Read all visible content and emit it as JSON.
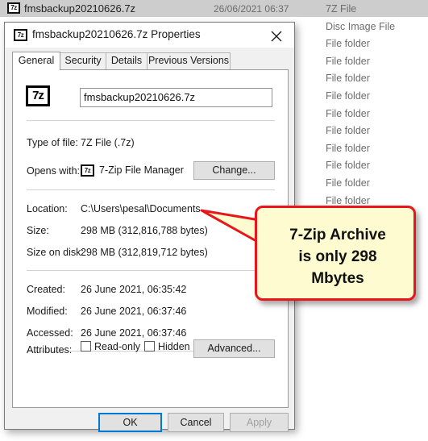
{
  "explorer": {
    "rows": [
      {
        "name": "fmsbackup20210626.7z",
        "date": "26/06/2021 06:37",
        "type": "7Z File",
        "icon": "7z-file-icon",
        "selected": true
      },
      {
        "name": "",
        "date": "",
        "type": "Disc Image File",
        "icon": "",
        "selected": false
      },
      {
        "name": "",
        "date": "",
        "type": "File folder",
        "icon": "",
        "selected": false
      },
      {
        "name": "",
        "date": "",
        "type": "File folder",
        "icon": "",
        "selected": false
      },
      {
        "name": "",
        "date": "",
        "type": "File folder",
        "icon": "",
        "selected": false
      },
      {
        "name": "",
        "date": "",
        "type": "File folder",
        "icon": "",
        "selected": false
      },
      {
        "name": "",
        "date": "",
        "type": "File folder",
        "icon": "",
        "selected": false
      },
      {
        "name": "",
        "date": "",
        "type": "File folder",
        "icon": "",
        "selected": false
      },
      {
        "name": "",
        "date": "",
        "type": "File folder",
        "icon": "",
        "selected": false
      },
      {
        "name": "",
        "date": "",
        "type": "File folder",
        "icon": "",
        "selected": false
      },
      {
        "name": "",
        "date": "",
        "type": "File folder",
        "icon": "",
        "selected": false
      },
      {
        "name": "",
        "date": "",
        "type": "File folder",
        "icon": "",
        "selected": false
      }
    ]
  },
  "dialog": {
    "title": "fmsbackup20210626.7z Properties",
    "title_icon": "7z",
    "close_icon": "close-icon",
    "tabs": [
      {
        "label": "General",
        "active": true
      },
      {
        "label": "Security",
        "active": false
      },
      {
        "label": "Details",
        "active": false
      },
      {
        "label": "Previous Versions",
        "active": false
      }
    ],
    "file_icon_text": "7z",
    "filename": "fmsbackup20210626.7z",
    "fields": [
      {
        "label": "Type of file:",
        "value": "7Z File (.7z)"
      },
      {
        "label": "Opens with:",
        "value": "7-Zip File Manager"
      },
      {
        "label": "Location:",
        "value": "C:\\Users\\pesal\\Documents"
      },
      {
        "label": "Size:",
        "value": "298 MB (312,816,788 bytes)"
      },
      {
        "label": "Size on disk:",
        "value": "298 MB (312,819,712 bytes)"
      },
      {
        "label": "Created:",
        "value": "26 June 2021, 06:35:42"
      },
      {
        "label": "Modified:",
        "value": "26 June 2021, 06:37:46"
      },
      {
        "label": "Accessed:",
        "value": "26 June 2021, 06:37:46"
      },
      {
        "label": "Attributes:",
        "value": ""
      }
    ],
    "change_button": "Change...",
    "advanced_button": "Advanced...",
    "readonly_checkbox": "Read-only",
    "hidden_checkbox": "Hidden",
    "ok_button": "OK",
    "cancel_button": "Cancel",
    "apply_button": "Apply"
  },
  "callout": {
    "text": "7-Zip Archive is only 298 Mbytes",
    "line1": "7-Zip Archive",
    "line2": "is only 298",
    "line3": "Mbytes",
    "fill_color": "#fdfbcf",
    "border_color": "#e8161a"
  }
}
